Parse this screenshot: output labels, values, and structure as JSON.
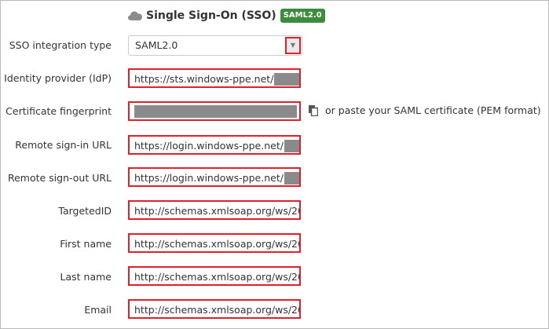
{
  "header": {
    "title": "Single Sign-On (SSO)",
    "badge": "SAML2.0"
  },
  "fields": {
    "integration_type": {
      "label": "SSO integration type",
      "value": "SAML2.0"
    },
    "idp": {
      "label": "Identity provider (IdP)",
      "value": "https://sts.windows-ppe.net/"
    },
    "cert": {
      "label": "Certificate fingerprint",
      "paste_hint": "or paste your SAML certificate (PEM format)"
    },
    "signin": {
      "label": "Remote sign-in URL",
      "value": "https://login.windows-ppe.net/"
    },
    "signout": {
      "label": "Remote sign-out URL",
      "value": "https://login.windows-ppe.net/"
    },
    "targeted_id": {
      "label": "TargetedID",
      "value": "http://schemas.xmlsoap.org/ws/20"
    },
    "first_name": {
      "label": "First name",
      "value": "http://schemas.xmlsoap.org/ws/20"
    },
    "last_name": {
      "label": "Last name",
      "value": "http://schemas.xmlsoap.org/ws/20"
    },
    "email": {
      "label": "Email",
      "value": "http://schemas.xmlsoap.org/ws/20"
    }
  },
  "colors": {
    "highlight": "#e0202b",
    "badge": "#3d8b3d",
    "redaction": "#8a8a8a"
  }
}
